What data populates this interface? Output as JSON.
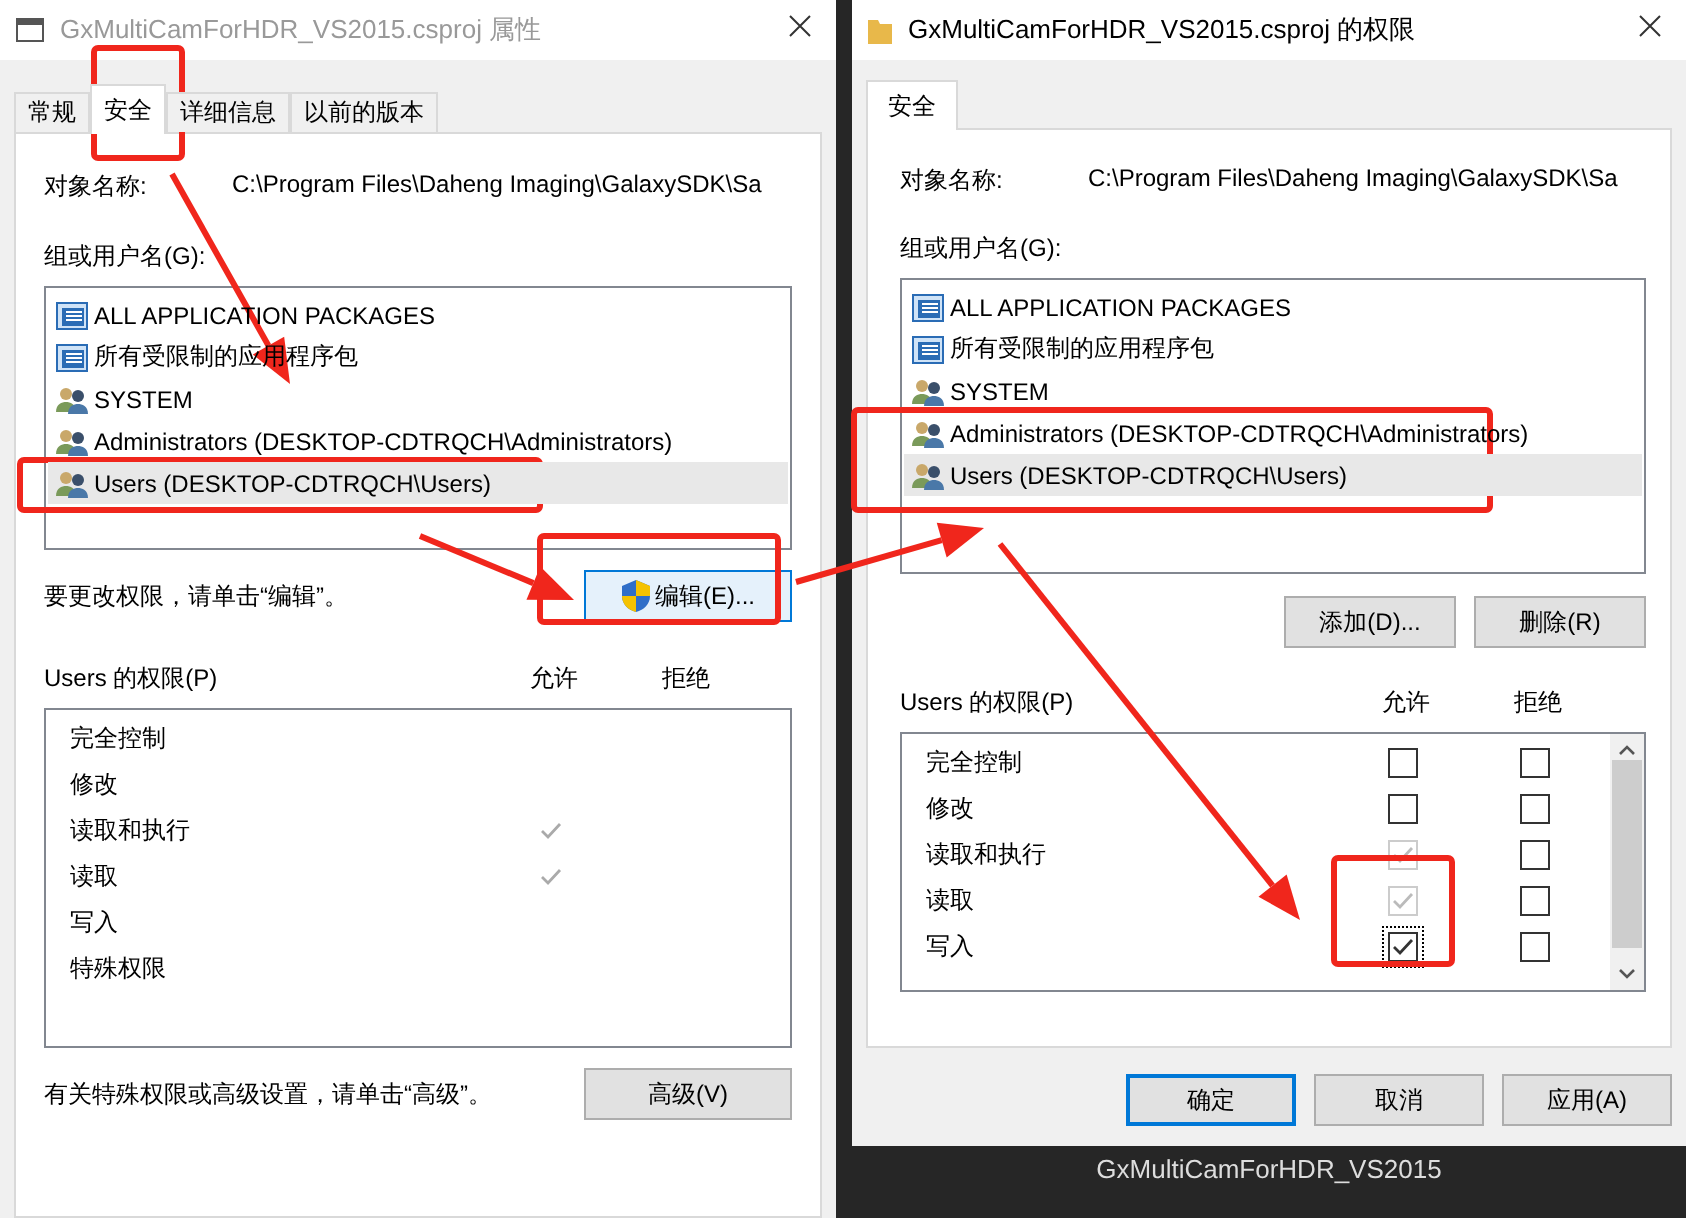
{
  "left_window": {
    "title": "GxMultiCamForHDR_VS2015.csproj 属性",
    "active": false,
    "tabs": [
      {
        "label": "常规",
        "selected": false
      },
      {
        "label": "安全",
        "selected": true
      },
      {
        "label": "详细信息",
        "selected": false
      },
      {
        "label": "以前的版本",
        "selected": false
      }
    ],
    "object_name_label": "对象名称:",
    "object_name_value": "C:\\Program Files\\Daheng Imaging\\GalaxySDK\\Sa",
    "groups_label": "组或用户名(G):",
    "groups": [
      {
        "name": "ALL APPLICATION PACKAGES",
        "kind": "package",
        "selected": false
      },
      {
        "name": "所有受限制的应用程序包",
        "kind": "package",
        "selected": false
      },
      {
        "name": "SYSTEM",
        "kind": "users",
        "selected": false
      },
      {
        "name": "Administrators (DESKTOP-CDTRQCH\\Administrators)",
        "kind": "users",
        "selected": false
      },
      {
        "name": "Users (DESKTOP-CDTRQCH\\Users)",
        "kind": "users",
        "selected": true
      }
    ],
    "edit_hint": "要更改权限，请单击“编辑”。",
    "edit_button": {
      "label": "编辑(E)...",
      "highlighted": true
    },
    "permissions_label": "Users 的权限(P)",
    "allow_header": "允许",
    "deny_header": "拒绝",
    "permissions": [
      {
        "name": "完全控制",
        "allow": false,
        "deny": false
      },
      {
        "name": "修改",
        "allow": false,
        "deny": false
      },
      {
        "name": "读取和执行",
        "allow": true,
        "deny": false
      },
      {
        "name": "读取",
        "allow": true,
        "deny": false
      },
      {
        "name": "写入",
        "allow": false,
        "deny": false
      },
      {
        "name": "特殊权限",
        "allow": false,
        "deny": false
      }
    ],
    "advanced_hint": "有关特殊权限或高级设置，请单击“高级”。",
    "advanced_button": {
      "label": "高级(V)",
      "highlighted": false
    }
  },
  "right_window": {
    "title": "GxMultiCamForHDR_VS2015.csproj 的权限",
    "active": true,
    "tabs": [
      {
        "label": "安全",
        "selected": true
      }
    ],
    "object_name_label": "对象名称:",
    "object_name_value": "C:\\Program Files\\Daheng Imaging\\GalaxySDK\\Sa",
    "groups_label": "组或用户名(G):",
    "groups": [
      {
        "name": "ALL APPLICATION PACKAGES",
        "kind": "package",
        "selected": false
      },
      {
        "name": "所有受限制的应用程序包",
        "kind": "package",
        "selected": false
      },
      {
        "name": "SYSTEM",
        "kind": "users",
        "selected": false
      },
      {
        "name": "Administrators (DESKTOP-CDTRQCH\\Administrators)",
        "kind": "users",
        "selected": false
      },
      {
        "name": "Users (DESKTOP-CDTRQCH\\Users)",
        "kind": "users",
        "selected": true
      }
    ],
    "add_button": "添加(D)...",
    "remove_button": "删除(R)",
    "permissions_label": "Users 的权限(P)",
    "allow_header": "允许",
    "deny_header": "拒绝",
    "permissions": [
      {
        "name": "完全控制",
        "allow": false,
        "inherited": false,
        "deny": false,
        "focused": false
      },
      {
        "name": "修改",
        "allow": false,
        "inherited": false,
        "deny": false,
        "focused": false
      },
      {
        "name": "读取和执行",
        "allow": true,
        "inherited": true,
        "deny": false,
        "focused": false
      },
      {
        "name": "读取",
        "allow": true,
        "inherited": true,
        "deny": false,
        "focused": false
      },
      {
        "name": "写入",
        "allow": true,
        "inherited": false,
        "deny": false,
        "focused": true
      }
    ],
    "buttons": [
      {
        "label": "确定",
        "default": true
      },
      {
        "label": "取消",
        "default": false
      },
      {
        "label": "应用(A)",
        "default": false
      }
    ]
  },
  "desktop_label": "GxMultiCamForHDR_VS2015"
}
